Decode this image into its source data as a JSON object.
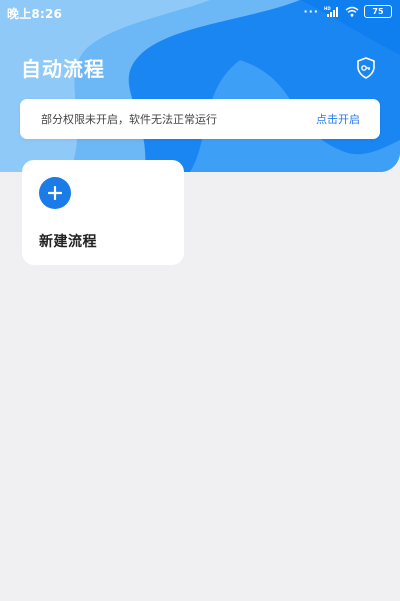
{
  "status_bar": {
    "time": "晚上8:26",
    "battery": "75",
    "signal_label": "HD"
  },
  "header": {
    "title": "自动流程",
    "shield_icon": "shield-key-icon"
  },
  "notice": {
    "text": "部分权限未开启，软件无法正常运行",
    "action_label": "点击开启"
  },
  "new_flow_card": {
    "icon": "plus-icon",
    "label": "新建流程"
  },
  "colors": {
    "accent": "#1b7ce8",
    "header_dark": "#1a86f2",
    "header_mid": "#3da2f7",
    "header_light": "#8cc8f6",
    "link": "#2a7be8",
    "background": "#f0f0f2"
  }
}
